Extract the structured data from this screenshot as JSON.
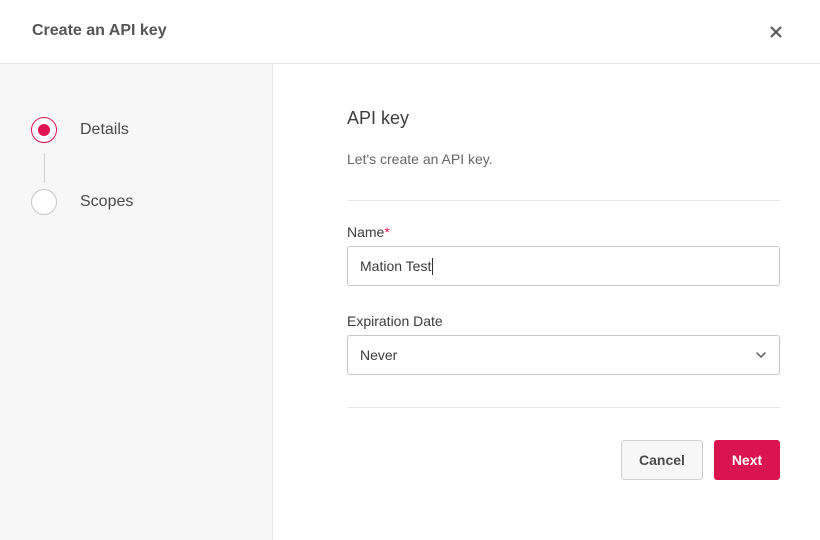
{
  "dialog": {
    "title": "Create an API key",
    "close_icon": "close-icon"
  },
  "steps": [
    {
      "label": "Details",
      "state": "active"
    },
    {
      "label": "Scopes",
      "state": "inactive"
    }
  ],
  "main": {
    "title": "API key",
    "description": "Let's create an API key.",
    "name_field": {
      "label": "Name",
      "required_marker": "*",
      "value": "Mation Test"
    },
    "expiration_field": {
      "label": "Expiration Date",
      "selected": "Never",
      "icon": "chevron-down-icon"
    },
    "cancel_label": "Cancel",
    "next_label": "Next"
  },
  "colors": {
    "accent": "#d9144f",
    "sidebar_bg": "#f7f7f8",
    "border": "#e6e6e6"
  }
}
